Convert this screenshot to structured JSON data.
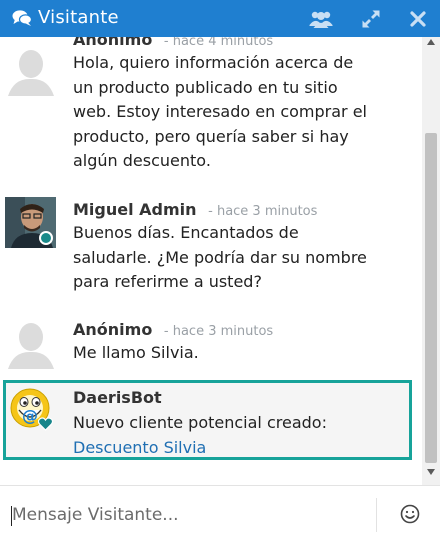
{
  "header": {
    "title": "Visitante"
  },
  "messages": [
    {
      "author": "Anónimo",
      "time": "- hace 4 minutos",
      "lines": [
        "Hola, quiero información acerca de",
        "un producto publicado en tu sitio",
        "web. Estoy interesado en comprar el",
        "producto, pero quería saber si hay",
        "algún descuento."
      ]
    },
    {
      "author": "Miguel Admin",
      "time": "- hace 3 minutos",
      "lines": [
        "Buenos días. Encantados de",
        "saludarle. ¿Me podría dar su nombre",
        "para referirme a usted?"
      ]
    },
    {
      "author": "Anónimo",
      "time": "- hace 3 minutos",
      "lines": [
        "Me llamo Silvia."
      ]
    },
    {
      "author": "DaerisBot",
      "time": "",
      "lines": [
        "Nuevo cliente potencial creado:"
      ],
      "link": "Descuento Silvia"
    }
  ],
  "composer": {
    "placeholder": "Mensaje Visitante..."
  },
  "colors": {
    "header": "#1f7fd0",
    "highlight_border": "#17a39a",
    "link": "#1f6fb3",
    "online_dot": "#1a8a8a"
  },
  "icons": [
    "chat-bubbles-icon",
    "users-icon",
    "expand-icon",
    "close-icon",
    "smiley-icon"
  ]
}
